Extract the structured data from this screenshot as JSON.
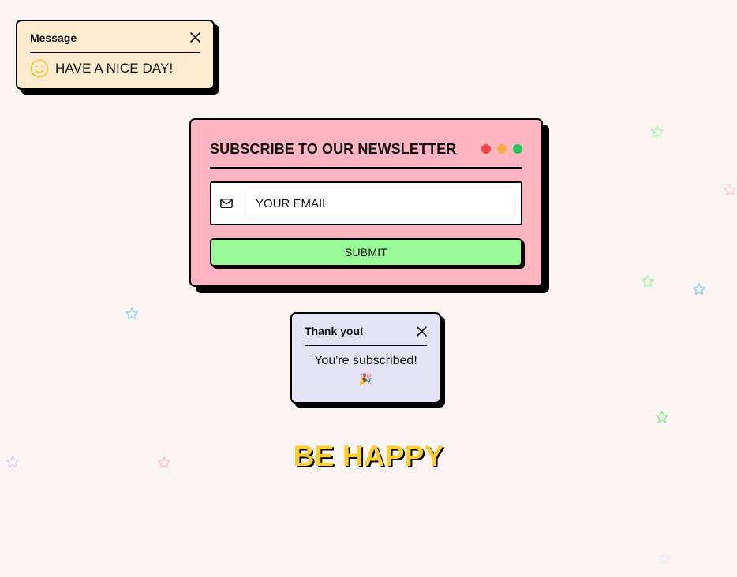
{
  "message_toast": {
    "title": "Message",
    "text": "HAVE A NICE DAY!",
    "icon": "smiley-icon",
    "close_icon": "close-icon",
    "background": "#ffeccf"
  },
  "newsletter": {
    "title": "SUBSCRIBE TO OUR NEWSLETTER",
    "window_dots": [
      "#ef4444",
      "#f5b041",
      "#22c55e"
    ],
    "email_placeholder": "YOUR EMAIL",
    "email_value": "",
    "mail_icon": "envelope-icon",
    "submit_label": "SUBMIT",
    "background": "#ffb6c1",
    "submit_color": "#98fb98"
  },
  "thanks_toast": {
    "title": "Thank you!",
    "text": "You're subscribed!",
    "emoji": "🎉",
    "close_icon": "close-icon",
    "background": "#e4e4f6"
  },
  "headline": {
    "text": "BE HAPPY",
    "color": "#ffd02b"
  },
  "decor": {
    "star_colors": [
      "#98fb98",
      "#ffb6c1",
      "#87ceeb",
      "#c8c8f0"
    ]
  }
}
